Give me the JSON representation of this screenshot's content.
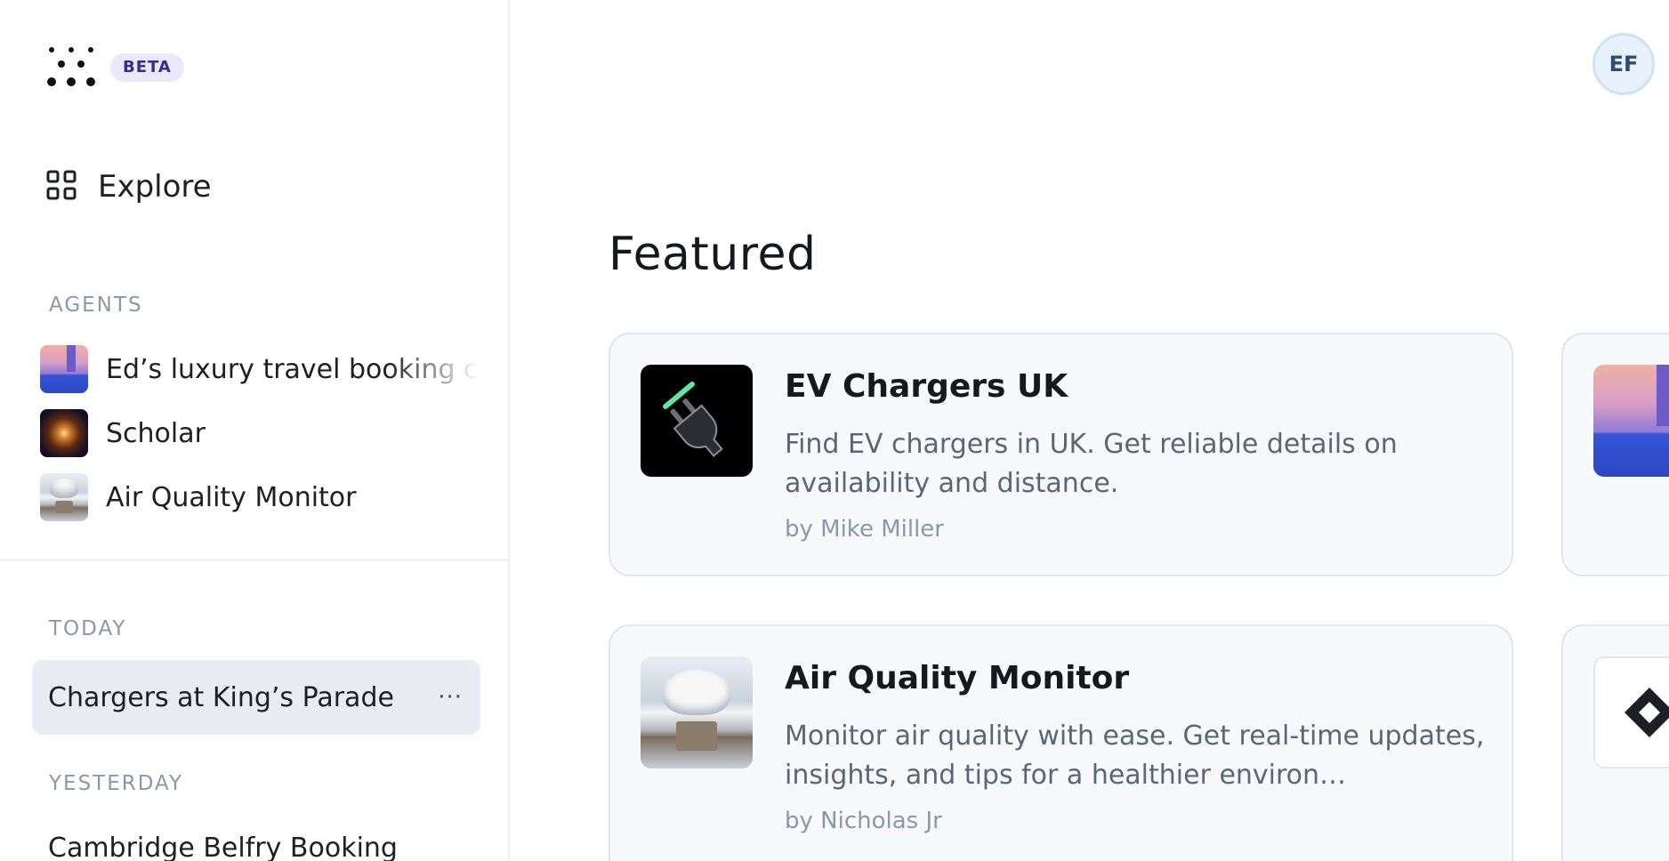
{
  "app": {
    "badge": "BETA"
  },
  "user": {
    "initials": "EF"
  },
  "nav": {
    "explore_label": "Explore"
  },
  "sidebar": {
    "agents_label": "AGENTS",
    "agents": [
      {
        "name": "Ed’s luxury travel booking c",
        "thumb": "travel-thumbnail"
      },
      {
        "name": "Scholar",
        "thumb": "galaxy-thumbnail"
      },
      {
        "name": "Air Quality Monitor",
        "thumb": "cloud-thumbnail"
      }
    ],
    "today_label": "TODAY",
    "today_chats": [
      {
        "title": "Chargers at King’s Parade",
        "more": "···"
      }
    ],
    "yesterday_label": "YESTERDAY",
    "yesterday_chats": [
      {
        "title": "Cambridge Belfry Booking"
      }
    ]
  },
  "main": {
    "section_title": "Featured",
    "cards": [
      {
        "title": "EV Chargers UK",
        "description": "Find EV chargers in UK. Get reliable details on availability and distance.",
        "author": "by Mike Miller",
        "thumb": "ev-plug-icon"
      },
      {
        "title": "Air Quality Monitor",
        "description": "Monitor air quality with ease. Get real-time updates, insights, and tips for a healthier environ…",
        "author": "by Nicholas Jr",
        "thumb": "cloud-thumbnail"
      }
    ]
  },
  "colors": {
    "accent_badge_bg": "#ece8fb",
    "accent_badge_text": "#3a2a8a",
    "active_row_bg": "#e9ecf1",
    "card_bg": "#f8f9fb",
    "muted_text": "#8a97ad"
  }
}
